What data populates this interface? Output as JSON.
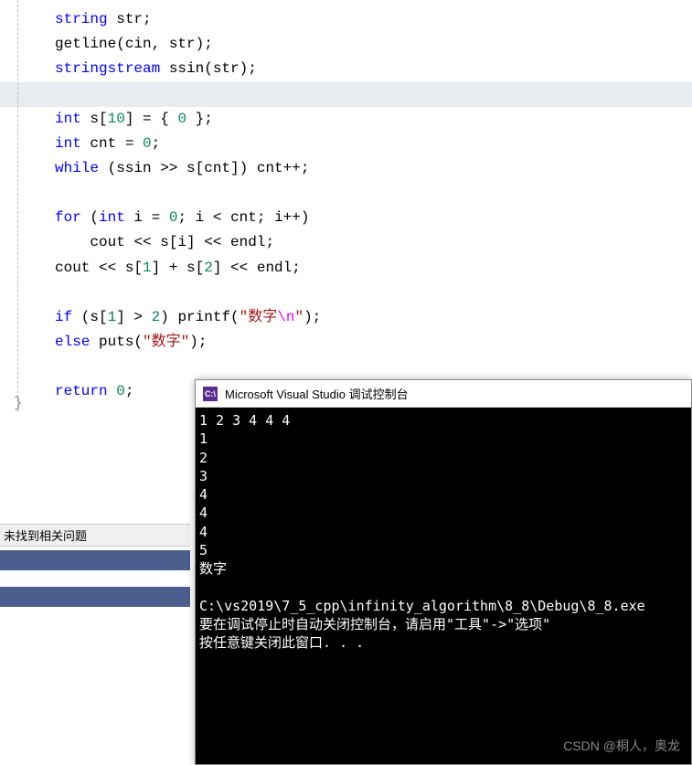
{
  "code": {
    "line1_a": "string",
    "line1_b": " str;",
    "line2_a": "getline",
    "line2_b": "(cin, str);",
    "line3_a": "stringstream",
    "line3_b": " ssin(str);",
    "line5_a": "int",
    "line5_b": " s[",
    "line5_c": "10",
    "line5_d": "] = { ",
    "line5_e": "0",
    "line5_f": " };",
    "line6_a": "int",
    "line6_b": " cnt = ",
    "line6_c": "0",
    "line6_d": ";",
    "line7_a": "while",
    "line7_b": " (ssin >> s[cnt]) cnt++;",
    "line9_a": "for",
    "line9_b": " (",
    "line9_c": "int",
    "line9_d": " i = ",
    "line9_e": "0",
    "line9_f": "; i < cnt; i++)",
    "line10_a": "    cout << s[i] << endl;",
    "line11_a": "cout << s[",
    "line11_b": "1",
    "line11_c": "] + s[",
    "line11_d": "2",
    "line11_e": "] << endl;",
    "line13_a": "if",
    "line13_b": " (s[",
    "line13_c": "1",
    "line13_d": "] > ",
    "line13_e": "2",
    "line13_f": ") printf(",
    "line13_g": "\"数字",
    "line13_h": "\\n",
    "line13_i": "\"",
    "line13_j": ");",
    "line14_a": "else",
    "line14_b": " puts(",
    "line14_c": "\"数字\"",
    "line14_d": ");",
    "line16_a": "return",
    "line16_b": " ",
    "line16_c": "0",
    "line16_d": ";",
    "closing_brace": "}"
  },
  "panel": {
    "no_issues": "未找到相关问题"
  },
  "console": {
    "icon_text": "C:\\",
    "title": "Microsoft Visual Studio 调试控制台",
    "output_input": "1 2 3 4 4 4",
    "output_l1": "1",
    "output_l2": "2",
    "output_l3": "3",
    "output_l4": "4",
    "output_l5": "4",
    "output_l6": "4",
    "output_l7": "5",
    "output_l8": "数字",
    "output_path": "C:\\vs2019\\7_5_cpp\\infinity_algorithm\\8_8\\Debug\\8_8.exe",
    "output_msg1": "要在调试停止时自动关闭控制台，请启用\"工具\"->\"选项\"",
    "output_msg2": "按任意键关闭此窗口. . ."
  },
  "watermark": "CSDN @桐人，奥龙"
}
